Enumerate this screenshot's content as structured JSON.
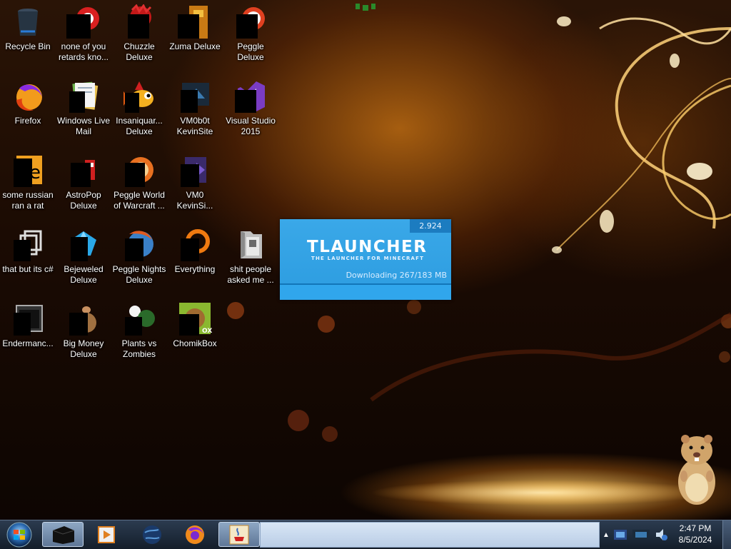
{
  "desktop": {
    "icons": [
      {
        "label": "Recycle Bin",
        "icon": "recycle-bin-icon"
      },
      {
        "label": "none of you retards kno...",
        "icon": "generic-app-icon"
      },
      {
        "label": "Chuzzle Deluxe",
        "icon": "chuzzle-icon"
      },
      {
        "label": "Zuma Deluxe",
        "icon": "zuma-icon"
      },
      {
        "label": "Peggle Deluxe",
        "icon": "peggle-icon"
      },
      {
        "label": "Firefox",
        "icon": "firefox-icon"
      },
      {
        "label": "Windows Live Mail",
        "icon": "windows-live-mail-icon"
      },
      {
        "label": "Insaniquar... Deluxe",
        "icon": "insaniquarium-icon"
      },
      {
        "label": "VM0b0t KevinSite",
        "icon": "shortcut-icon"
      },
      {
        "label": "Visual Studio 2015",
        "icon": "visual-studio-icon"
      },
      {
        "label": "some russian ran a rat",
        "icon": "generic-app-icon"
      },
      {
        "label": "AstroPop Deluxe",
        "icon": "astropop-icon"
      },
      {
        "label": "Peggle World of Warcraft ...",
        "icon": "peggle-wow-icon"
      },
      {
        "label": "VM0 KevinSi...",
        "icon": "shortcut-icon"
      },
      {
        "label": "that but its c#",
        "icon": "copy-files-icon"
      },
      {
        "label": "Bejeweled Deluxe",
        "icon": "bejeweled-icon"
      },
      {
        "label": "Peggle Nights Deluxe",
        "icon": "peggle-nights-icon"
      },
      {
        "label": "Everything",
        "icon": "everything-search-icon"
      },
      {
        "label": "shit people asked me ...",
        "icon": "folder-icon"
      },
      {
        "label": "Endermanc...",
        "icon": "terminal-icon"
      },
      {
        "label": "Big Money Deluxe",
        "icon": "big-money-icon"
      },
      {
        "label": "Plants vs Zombies",
        "icon": "plants-vs-zombies-icon"
      },
      {
        "label": "ChomikBox",
        "icon": "chomikbox-icon"
      }
    ]
  },
  "tlauncher": {
    "version": "2.924",
    "title": "TLAUNCHER",
    "subtitle": "THE LAUNCHER FOR MINECRAFT",
    "status": "Downloading 267/183 MB",
    "progress_fraction": 1.0
  },
  "taskbar": {
    "pinned": [
      {
        "name": "taskbar-app-terminal",
        "icon": "terminal-icon",
        "active": true
      },
      {
        "name": "taskbar-app-media-player",
        "icon": "media-player-icon",
        "active": false
      },
      {
        "name": "taskbar-app-browser-globe",
        "icon": "globe-icon",
        "active": false
      },
      {
        "name": "taskbar-app-firefox",
        "icon": "firefox-icon",
        "active": false
      },
      {
        "name": "taskbar-app-java",
        "icon": "java-icon",
        "active": true
      }
    ],
    "clock_time": "2:47 PM",
    "clock_date": "8/5/2024"
  },
  "colors": {
    "tlauncher_blue": "#2c9ce0",
    "taskbar_dark": "#1d2a3a"
  }
}
